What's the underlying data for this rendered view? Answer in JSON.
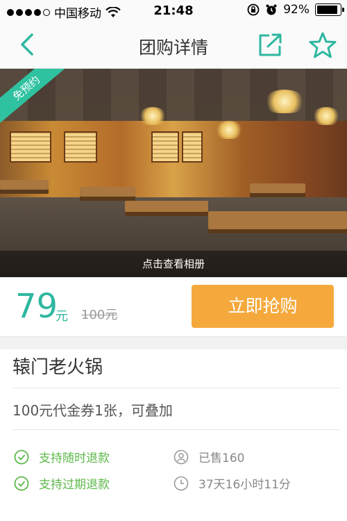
{
  "status_bar": {
    "carrier": "中国移动",
    "time": "21:48",
    "battery": "92%"
  },
  "nav": {
    "title": "团购详情"
  },
  "hero": {
    "badge": "免预约",
    "overlay_text": "点击查看相册"
  },
  "price": {
    "current": "79",
    "unit": "元",
    "original": "100元",
    "buy_label": "立即抢购"
  },
  "detail": {
    "shop_name": "辕门老火锅",
    "description": "100元代金券1张，可叠加",
    "features": [
      {
        "text": "支持随时退款",
        "icon": "check-circle-icon"
      },
      {
        "text": "支持过期退款",
        "icon": "check-circle-icon"
      },
      {
        "text": "已售160",
        "icon": "user-icon"
      },
      {
        "text": "37天16小时11分",
        "icon": "clock-icon"
      }
    ]
  },
  "colors": {
    "accent": "#2fb7a0",
    "buy_button": "#f5a93d",
    "green_text": "#5db84a"
  }
}
